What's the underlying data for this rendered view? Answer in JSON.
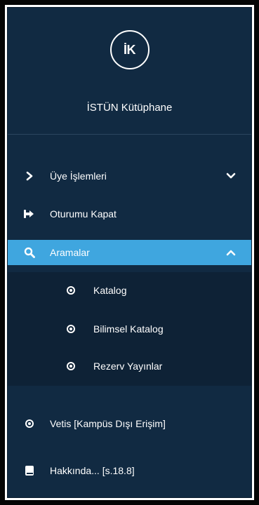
{
  "brand": {
    "logo_text": "İK",
    "title": "İSTÜN Kütüphane"
  },
  "menu": {
    "items": [
      {
        "label": "Üye İşlemleri",
        "icon": "chevron-right-icon",
        "toggle": "chevron-down-icon"
      },
      {
        "label": "Oturumu Kapat",
        "icon": "sign-out-icon"
      },
      {
        "label": "Aramalar",
        "icon": "search-icon",
        "toggle": "chevron-up-icon",
        "active": true
      },
      {
        "label": "Vetis [Kampüs Dışı Erişim]",
        "icon": "radio-dot-icon"
      },
      {
        "label": "Hakkında... [s.18.8]",
        "icon": "book-icon"
      }
    ],
    "submenu": [
      {
        "label": "Katalog",
        "icon": "radio-dot-icon"
      },
      {
        "label": "Bilimsel Katalog",
        "icon": "radio-dot-icon"
      },
      {
        "label": "Rezerv Yayınlar",
        "icon": "radio-dot-icon"
      }
    ]
  },
  "colors": {
    "sidebar_bg": "#112a42",
    "submenu_bg": "#0e2236",
    "active_bg": "#3fa6df",
    "text": "#ffffff"
  }
}
